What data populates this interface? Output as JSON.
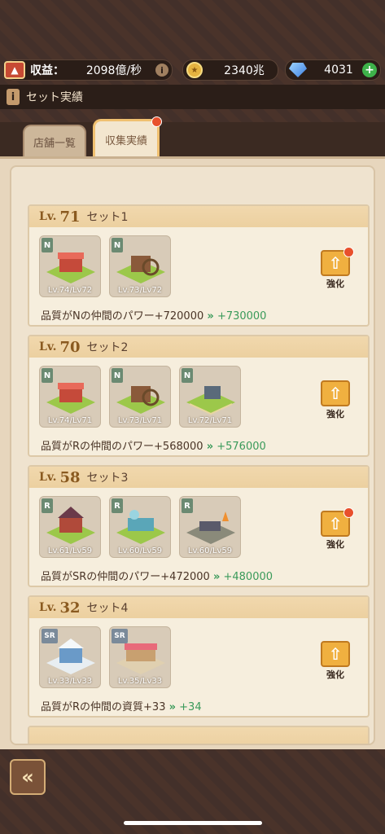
{
  "resources": {
    "income_label": "収益：",
    "income_value": "2098億/秒",
    "coins": "2340兆",
    "gems": "4031"
  },
  "header": {
    "title": "セット実績"
  },
  "tabs": [
    {
      "label": "店舗一覧",
      "active": false
    },
    {
      "label": "収集実績",
      "active": true
    }
  ],
  "sets": [
    {
      "level_prefix": "Lv.",
      "level": "71",
      "name": "セット1",
      "buildings": [
        {
          "rarity": "N",
          "level": "Lv.74/Lv72",
          "icon": "stall-building-icon"
        },
        {
          "rarity": "N",
          "level": "Lv.73/Lv72",
          "icon": "watermill-building-icon"
        }
      ],
      "enhance_label": "強化",
      "effect": "品質がNの仲間のパワー+720000",
      "effect_next": "+730000"
    },
    {
      "level_prefix": "Lv.",
      "level": "70",
      "name": "セット2",
      "buildings": [
        {
          "rarity": "N",
          "level": "Lv.74/Lv71",
          "icon": "stall-building-icon"
        },
        {
          "rarity": "N",
          "level": "Lv.73/Lv71",
          "icon": "watermill-building-icon"
        },
        {
          "rarity": "N",
          "level": "Lv.72/Lv71",
          "icon": "farm-building-icon"
        }
      ],
      "enhance_label": "強化",
      "effect": "品質がRの仲間のパワー+568000",
      "effect_next": "+576000"
    },
    {
      "level_prefix": "Lv.",
      "level": "58",
      "name": "セット3",
      "buildings": [
        {
          "rarity": "R",
          "level": "Lv.61/Lv59",
          "icon": "house-building-icon"
        },
        {
          "rarity": "R",
          "level": "Lv.60/Lv59",
          "icon": "workshop-building-icon"
        },
        {
          "rarity": "R",
          "level": "Lv.60/Lv59",
          "icon": "forge-building-icon"
        }
      ],
      "enhance_label": "強化",
      "effect": "品質がSRの仲間のパワー+472000",
      "effect_next": "+480000"
    },
    {
      "level_prefix": "Lv.",
      "level": "32",
      "name": "セット4",
      "buildings": [
        {
          "rarity": "SR",
          "level": "Lv.33/Lv33",
          "icon": "snow-building-icon"
        },
        {
          "rarity": "SR",
          "level": "Lv.35/Lv33",
          "icon": "market-building-icon"
        }
      ],
      "enhance_label": "強化",
      "effect": "品質がRの仲間の資質+33",
      "effect_next": "+34"
    }
  ],
  "colors": {
    "accent": "#f0b040",
    "positive": "#3a9a5a",
    "notify": "#e8502c"
  }
}
